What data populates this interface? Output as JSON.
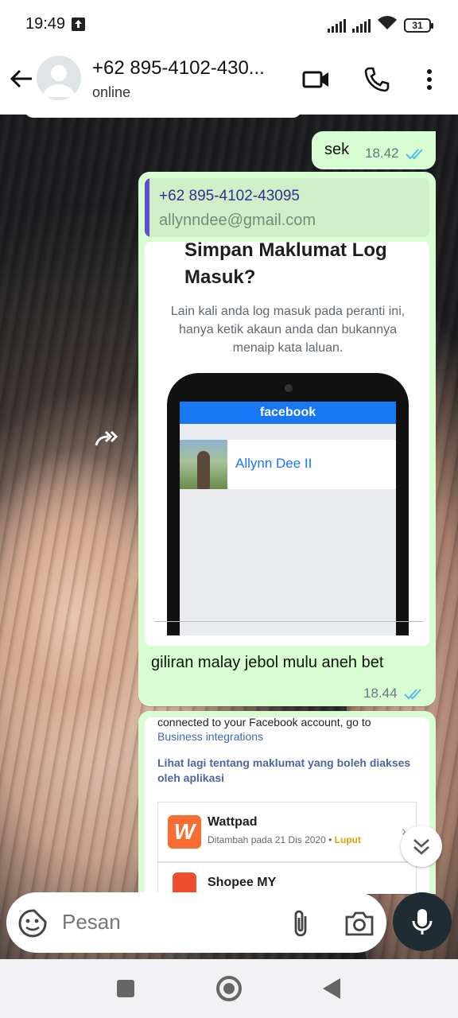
{
  "status_bar": {
    "time": "19:49",
    "battery": "31",
    "icons": [
      "upload-icon",
      "signal-icon",
      "signal-icon",
      "wifi-icon",
      "battery-icon"
    ]
  },
  "header": {
    "contact_name": "+62 895-4102-430...",
    "status": "online",
    "icons": [
      "back-arrow-icon",
      "video-call-icon",
      "phone-icon",
      "more-vert-icon"
    ]
  },
  "messages": [
    {
      "type": "outgoing",
      "text": "sek",
      "time": "18.42",
      "ticks": "read"
    },
    {
      "type": "outgoing",
      "quote": {
        "phone": "+62 895-4102-43095",
        "email": "allynndee@gmail.com"
      },
      "image": {
        "title": "Simpan Maklumat Log Masuk?",
        "description": "Lain kali anda log masuk pada peranti ini, hanya ketik akaun anda dan bukannya menaip kata laluan.",
        "brand": "facebook",
        "account_name": "Allynn Dee II"
      },
      "text": "giliran malay jebol mulu aneh bet",
      "time": "18.44",
      "ticks": "read"
    },
    {
      "type": "outgoing",
      "card": {
        "connected_text": "connected to your Facebook account, go to",
        "business_link": "Business integrations",
        "more_link": "Lihat lagi tentang maklumat yang boleh diakses oleh aplikasi",
        "apps": [
          {
            "name": "Wattpad",
            "logo_letter": "W",
            "added": "Ditambah pada 21 Dis 2020",
            "sep": "•",
            "state": "Luput"
          },
          {
            "name": "Shopee MY",
            "added": "",
            "state": ""
          }
        ]
      }
    }
  ],
  "composer": {
    "placeholder": "Pesan"
  },
  "colors": {
    "outgoing_bubble": "#d9fdd3",
    "read_ticks": "#53bdeb",
    "facebook_blue": "#1877f2",
    "wattpad_orange": "#f96c32",
    "expired_yellow": "#e5a100"
  }
}
